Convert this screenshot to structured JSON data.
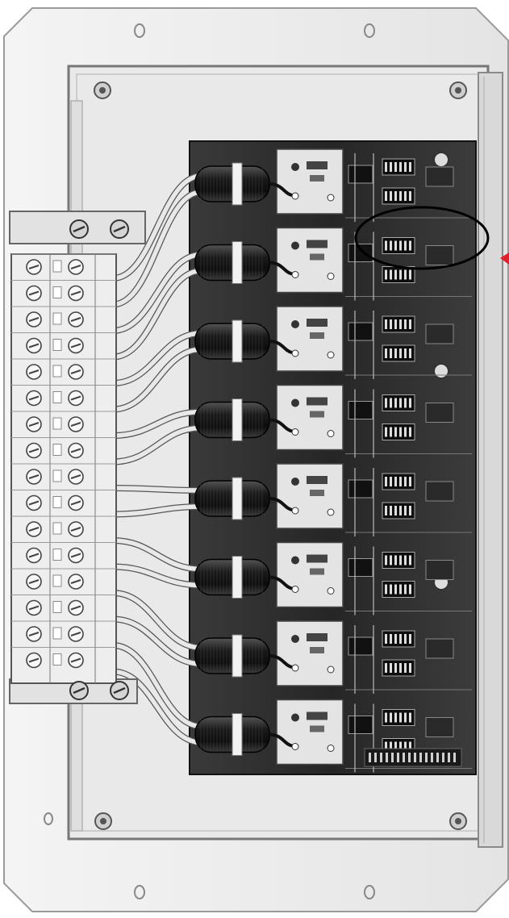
{
  "image": {
    "subject": "terminal-board-with-inductor-coils",
    "annotation": {
      "ellipse_color": "#000000",
      "pointer_color": "#e0202a"
    },
    "terminal_rows": 16,
    "coil_count": 8,
    "module_count": 8
  },
  "colors": {
    "plate": "#f2f2f2",
    "plate_edge": "#8a8a8a",
    "board": "#2a2a2a",
    "terminal_block": "#e6e6e6",
    "coil": "#1b1b1b",
    "wire": "#dcdcdc"
  }
}
